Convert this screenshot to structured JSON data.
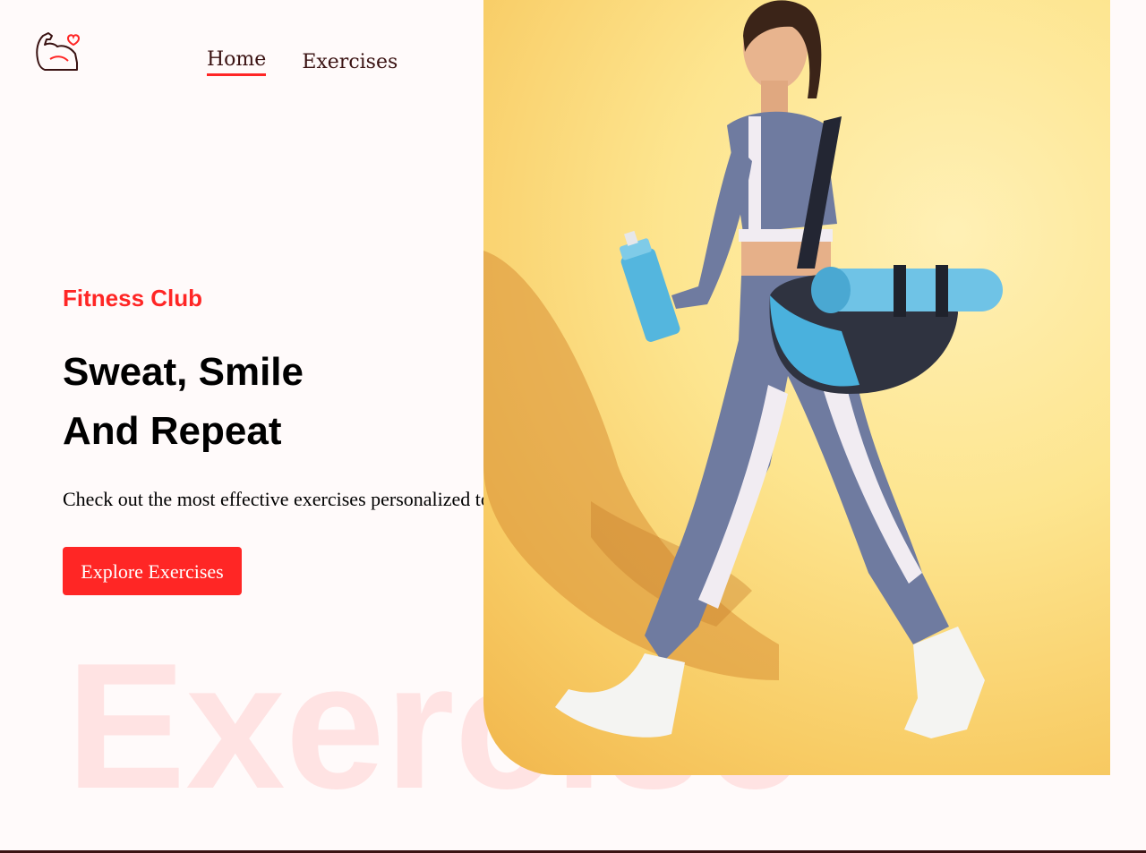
{
  "nav": {
    "home_label": "Home",
    "exercises_label": "Exercises"
  },
  "hero": {
    "eyebrow": "Fitness Club",
    "headline_line1": "Sweat, Smile",
    "headline_line2": "And Repeat",
    "subtext": "Check out the most effective exercises personalized to you",
    "cta_label": "Explore Exercises",
    "watermark": "Exercise"
  },
  "colors": {
    "accent": "#ff2625",
    "text_dark": "#3a1212",
    "background": "#fffafa"
  },
  "banner_image": {
    "subject": "woman-walking-with-gym-bag-and-shaker"
  }
}
